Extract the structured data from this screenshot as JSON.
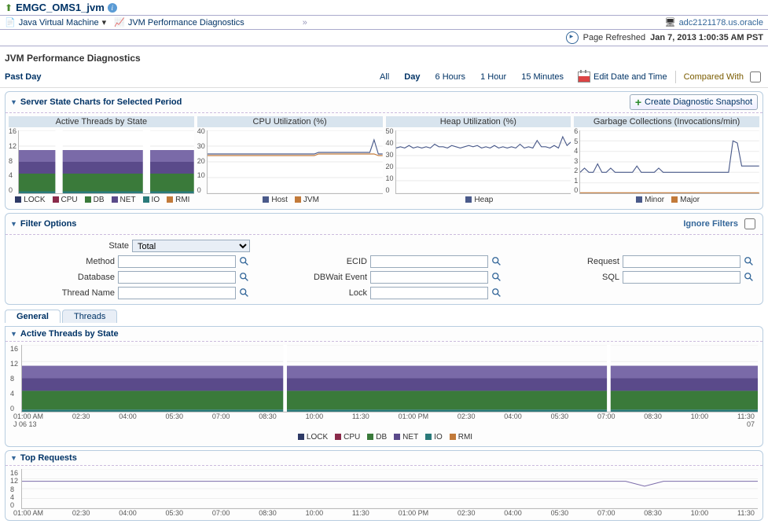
{
  "header": {
    "title": "EMGC_OMS1_jvm",
    "server_name": "adc2121178.us.oracle",
    "breadcrumb": {
      "item1": "Java Virtual Machine",
      "item2": "JVM Performance Diagnostics"
    },
    "refresh_prefix": "Page Refreshed",
    "refresh_time": "Jan 7, 2013 1:00:35 AM PST"
  },
  "page_title": "JVM Performance Diagnostics",
  "toolbar": {
    "period": "Past Day",
    "ranges": {
      "all": "All",
      "day": "Day",
      "six_hours": "6 Hours",
      "one_hour": "1 Hour",
      "fifteen_min": "15 Minutes"
    },
    "edit_dt": "Edit Date and Time",
    "compared_with": "Compared With"
  },
  "server_state": {
    "title": "Server State Charts for Selected Period",
    "create_snapshot": "Create Diagnostic Snapshot",
    "chart_titles": {
      "threads": "Active Threads by State",
      "cpu": "CPU Utilization (%)",
      "heap": "Heap Utilization (%)",
      "gc": "Garbage Collections (Invocations/min)"
    },
    "legends": {
      "threads": [
        "LOCK",
        "CPU",
        "DB",
        "NET",
        "IO",
        "RMI"
      ],
      "cpu": [
        "Host",
        "JVM"
      ],
      "heap": [
        "Heap"
      ],
      "gc": [
        "Minor",
        "Major"
      ]
    },
    "legend_colors": {
      "LOCK": "#2e3a66",
      "CPU": "#8a2a4a",
      "DB": "#3a7a3a",
      "NET": "#5a4a8a",
      "IO": "#2a7a7a",
      "RMI": "#c27a3a",
      "Host": "#4a5a8a",
      "JVM": "#c27a3a",
      "Heap": "#4a5a8a",
      "Minor": "#4a5a8a",
      "Major": "#c27a3a"
    }
  },
  "filter": {
    "title": "Filter Options",
    "ignore": "Ignore Filters",
    "fields": {
      "state": "State",
      "state_value": "Total",
      "method": "Method",
      "ecid": "ECID",
      "request": "Request",
      "database": "Database",
      "dbwait": "DBWait Event",
      "sql": "SQL",
      "thread": "Thread Name",
      "lock": "Lock"
    }
  },
  "tabs": {
    "general": "General",
    "threads": "Threads"
  },
  "active_threads": {
    "title": "Active Threads by State",
    "xlabels": [
      "01:00 AM",
      "02:30",
      "04:00",
      "05:30",
      "07:00",
      "08:30",
      "10:00",
      "11:30",
      "01:00 PM",
      "02:30",
      "04:00",
      "05:30",
      "07:00",
      "08:30",
      "10:00",
      "11:30"
    ],
    "sub_start": "J 06 13",
    "sub_end": "07",
    "legend": [
      "LOCK",
      "CPU",
      "DB",
      "NET",
      "IO",
      "RMI"
    ]
  },
  "top_requests": {
    "title": "Top Requests",
    "xlabels": [
      "01:00 AM",
      "02:30",
      "04:00",
      "05:30",
      "07:00",
      "08:30",
      "10:00",
      "11:30",
      "01:00 PM",
      "02:30",
      "04:00",
      "05:30",
      "07:00",
      "08:30",
      "10:00",
      "11:30"
    ]
  },
  "chart_data": [
    {
      "type": "area",
      "title": "Active Threads by State (small)",
      "ylim": [
        0,
        16
      ],
      "yticks": [
        0,
        4,
        8,
        12,
        16
      ],
      "categories_count": 48,
      "series": [
        {
          "name": "IO",
          "color": "#2a7a7a",
          "base": 0,
          "height": 0.5
        },
        {
          "name": "DB",
          "color": "#3a7a3a",
          "base": 0.5,
          "height": 4.5
        },
        {
          "name": "NET",
          "color": "#5a4a8a",
          "base": 5,
          "height": 3
        },
        {
          "name": "LOCK",
          "color": "#7a6aa8",
          "base": 8,
          "height": 3
        }
      ],
      "gaps": [
        [
          10,
          12
        ],
        [
          34,
          36
        ]
      ]
    },
    {
      "type": "line",
      "title": "CPU Utilization (%)",
      "ylim": [
        0,
        40
      ],
      "yticks": [
        0,
        10,
        20,
        30,
        40
      ],
      "series": [
        {
          "name": "Host",
          "color": "#4a5a8a",
          "values": [
            25,
            25,
            25,
            25,
            25,
            25,
            25,
            25,
            25,
            25,
            25,
            25,
            25,
            25,
            25,
            25,
            25,
            25,
            25,
            25,
            25,
            25,
            25,
            25,
            25,
            25,
            26,
            26,
            26,
            26,
            26,
            26,
            26,
            26,
            26,
            26,
            26,
            26,
            26,
            34,
            25,
            25
          ]
        },
        {
          "name": "JVM",
          "color": "#c27a3a",
          "values": [
            24,
            24,
            24,
            24,
            24,
            24,
            24,
            24,
            24,
            24,
            24,
            24,
            24,
            24,
            24,
            24,
            24,
            24,
            24,
            24,
            24,
            24,
            24,
            24,
            24,
            24,
            25,
            25,
            25,
            25,
            25,
            25,
            25,
            25,
            25,
            25,
            25,
            25,
            25,
            25,
            24,
            24
          ]
        }
      ]
    },
    {
      "type": "line",
      "title": "Heap Utilization (%)",
      "ylim": [
        0,
        50
      ],
      "yticks": [
        0,
        10,
        20,
        30,
        40,
        50
      ],
      "series": [
        {
          "name": "Heap",
          "color": "#4a5a8a",
          "values": [
            36,
            37,
            36,
            38,
            36,
            37,
            36,
            37,
            36,
            39,
            37,
            37,
            36,
            38,
            37,
            36,
            37,
            38,
            37,
            38,
            36,
            37,
            36,
            38,
            36,
            37,
            36,
            37,
            36,
            39,
            36,
            37,
            36,
            42,
            37,
            37,
            36,
            38,
            36,
            45,
            38,
            41
          ]
        }
      ]
    },
    {
      "type": "line",
      "title": "Garbage Collections (Invocations/min)",
      "ylim": [
        0,
        6
      ],
      "yticks": [
        0,
        1,
        2,
        3,
        4,
        5,
        6
      ],
      "series": [
        {
          "name": "Minor",
          "color": "#4a5a8a",
          "values": [
            2,
            2.4,
            2,
            2,
            2.8,
            2,
            2,
            2.4,
            2,
            2,
            2,
            2,
            2,
            2.6,
            2,
            2,
            2,
            2,
            2.4,
            2,
            2,
            2,
            2,
            2,
            2,
            2,
            2,
            2,
            2,
            2,
            2,
            2,
            2,
            2,
            2,
            5,
            4.8,
            2.6,
            2.6,
            2.6,
            2.6,
            2.6
          ]
        },
        {
          "name": "Major",
          "color": "#c27a3a",
          "values": [
            0.05,
            0.05,
            0.05,
            0.05,
            0.05,
            0.05,
            0.05,
            0.05,
            0.05,
            0.05,
            0.05,
            0.05,
            0.05,
            0.05,
            0.05,
            0.05,
            0.05,
            0.05,
            0.05,
            0.05,
            0.05,
            0.05,
            0.05,
            0.05,
            0.05,
            0.05,
            0.05,
            0.05,
            0.05,
            0.05,
            0.05,
            0.05,
            0.05,
            0.05,
            0.05,
            0.05,
            0.05,
            0.05,
            0.05,
            0.05,
            0.05,
            0.05
          ]
        }
      ]
    },
    {
      "type": "area",
      "title": "Active Threads by State (large)",
      "ylim": [
        0,
        16
      ],
      "yticks": [
        0,
        4,
        8,
        12,
        16
      ],
      "series": [
        {
          "name": "IO",
          "color": "#2a7a7a",
          "base": 0,
          "height": 0.5
        },
        {
          "name": "DB",
          "color": "#3a7a3a",
          "base": 0.5,
          "height": 4.5
        },
        {
          "name": "NET",
          "color": "#5a4a8a",
          "base": 5,
          "height": 3
        },
        {
          "name": "LOCK",
          "color": "#7a6aa8",
          "base": 8,
          "height": 3
        }
      ],
      "gaps": [
        [
          0.355,
          0.36
        ],
        [
          0.795,
          0.8
        ]
      ],
      "dips": [
        [
          0.82,
          3
        ]
      ]
    },
    {
      "type": "line",
      "title": "Top Requests",
      "ylim": [
        0,
        16
      ],
      "yticks": [
        0,
        4,
        8,
        12,
        16
      ],
      "series": [
        {
          "name": "req",
          "color": "#7b6baa",
          "values": [
            11,
            11,
            11,
            11,
            11,
            11,
            11,
            11,
            11,
            11,
            11,
            11,
            11,
            11,
            11,
            11,
            11,
            11,
            11,
            11,
            11,
            11,
            11,
            11,
            11,
            11,
            11,
            11,
            11,
            11,
            11,
            11,
            11,
            9,
            11,
            11,
            11,
            11,
            11,
            11
          ]
        }
      ]
    }
  ]
}
